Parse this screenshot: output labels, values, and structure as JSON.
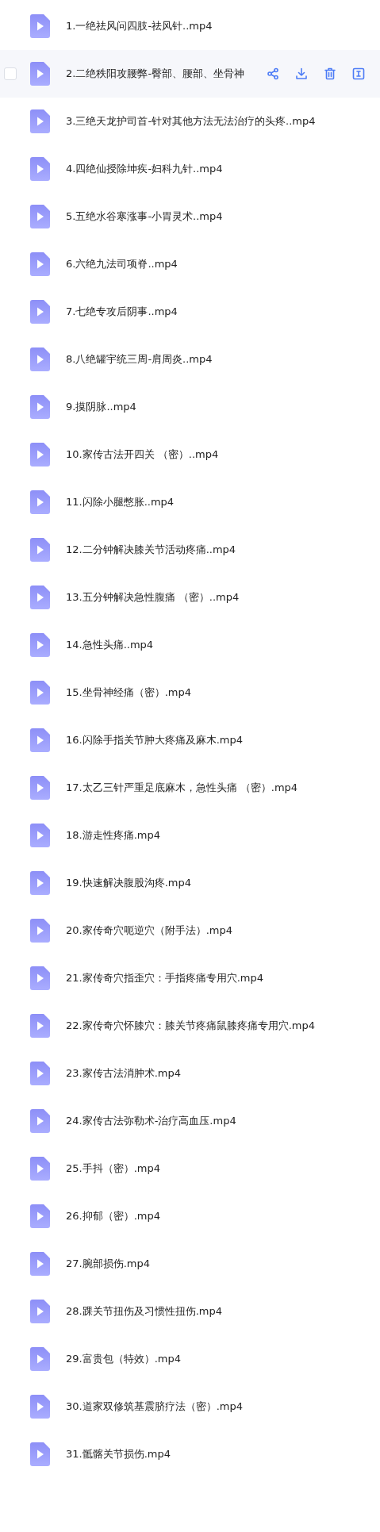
{
  "files": [
    {
      "name": "1.一绝祛风问四肢-祛风针..mp4",
      "hovered": false
    },
    {
      "name": "2.二绝秩阳攻腰弊-臀部、腰部、坐骨神",
      "hovered": true,
      "checked": false
    },
    {
      "name": "3.三绝天龙护司首-针对其他方法无法治疗的头疼..mp4",
      "hovered": false
    },
    {
      "name": "4.四绝仙授除坤疾-妇科九针..mp4",
      "hovered": false
    },
    {
      "name": "5.五绝水谷寒涨事-小胃灵术..mp4",
      "hovered": false
    },
    {
      "name": "6.六绝九法司项脊..mp4",
      "hovered": false
    },
    {
      "name": "7.七绝专攻后阴事..mp4",
      "hovered": false
    },
    {
      "name": "8.八绝罐宇统三周-肩周炎..mp4",
      "hovered": false
    },
    {
      "name": "9.摸阴脉..mp4",
      "hovered": false
    },
    {
      "name": "10.家传古法开四关 （密）..mp4",
      "hovered": false
    },
    {
      "name": "11.闪除小腿憋胀..mp4",
      "hovered": false
    },
    {
      "name": "12.二分钟解决膝关节活动疼痛..mp4",
      "hovered": false
    },
    {
      "name": "13.五分钟解决急性腹痛 （密）..mp4",
      "hovered": false
    },
    {
      "name": "14.急性头痛..mp4",
      "hovered": false
    },
    {
      "name": "15.坐骨神经痛（密）.mp4",
      "hovered": false
    },
    {
      "name": "16.闪除手指关节肿大疼痛及麻木.mp4",
      "hovered": false
    },
    {
      "name": "17.太乙三针严重足底麻木，急性头痛 （密）.mp4",
      "hovered": false
    },
    {
      "name": "18.游走性疼痛.mp4",
      "hovered": false
    },
    {
      "name": "19.快速解决腹股沟疼.mp4",
      "hovered": false
    },
    {
      "name": "20.家传奇穴呃逆穴（附手法）.mp4",
      "hovered": false
    },
    {
      "name": "21.家传奇穴指歪穴：手指疼痛专用穴.mp4",
      "hovered": false
    },
    {
      "name": "22.家传奇穴怀膝穴：膝关节疼痛鼠膝疼痛专用穴.mp4",
      "hovered": false
    },
    {
      "name": "23.家传古法消肿术.mp4",
      "hovered": false
    },
    {
      "name": "24.家传古法弥勒术-治疗高血压.mp4",
      "hovered": false
    },
    {
      "name": "25.手抖（密）.mp4",
      "hovered": false
    },
    {
      "name": "26.抑郁（密）.mp4",
      "hovered": false
    },
    {
      "name": "27.腕部损伤.mp4",
      "hovered": false
    },
    {
      "name": "28.踝关节扭伤及习惯性扭伤.mp4",
      "hovered": false
    },
    {
      "name": "29.富贵包（特效）.mp4",
      "hovered": false
    },
    {
      "name": "30.道家双修筑基震脐疗法（密）.mp4",
      "hovered": false
    },
    {
      "name": "31.骶髂关节损伤.mp4",
      "hovered": false
    }
  ]
}
